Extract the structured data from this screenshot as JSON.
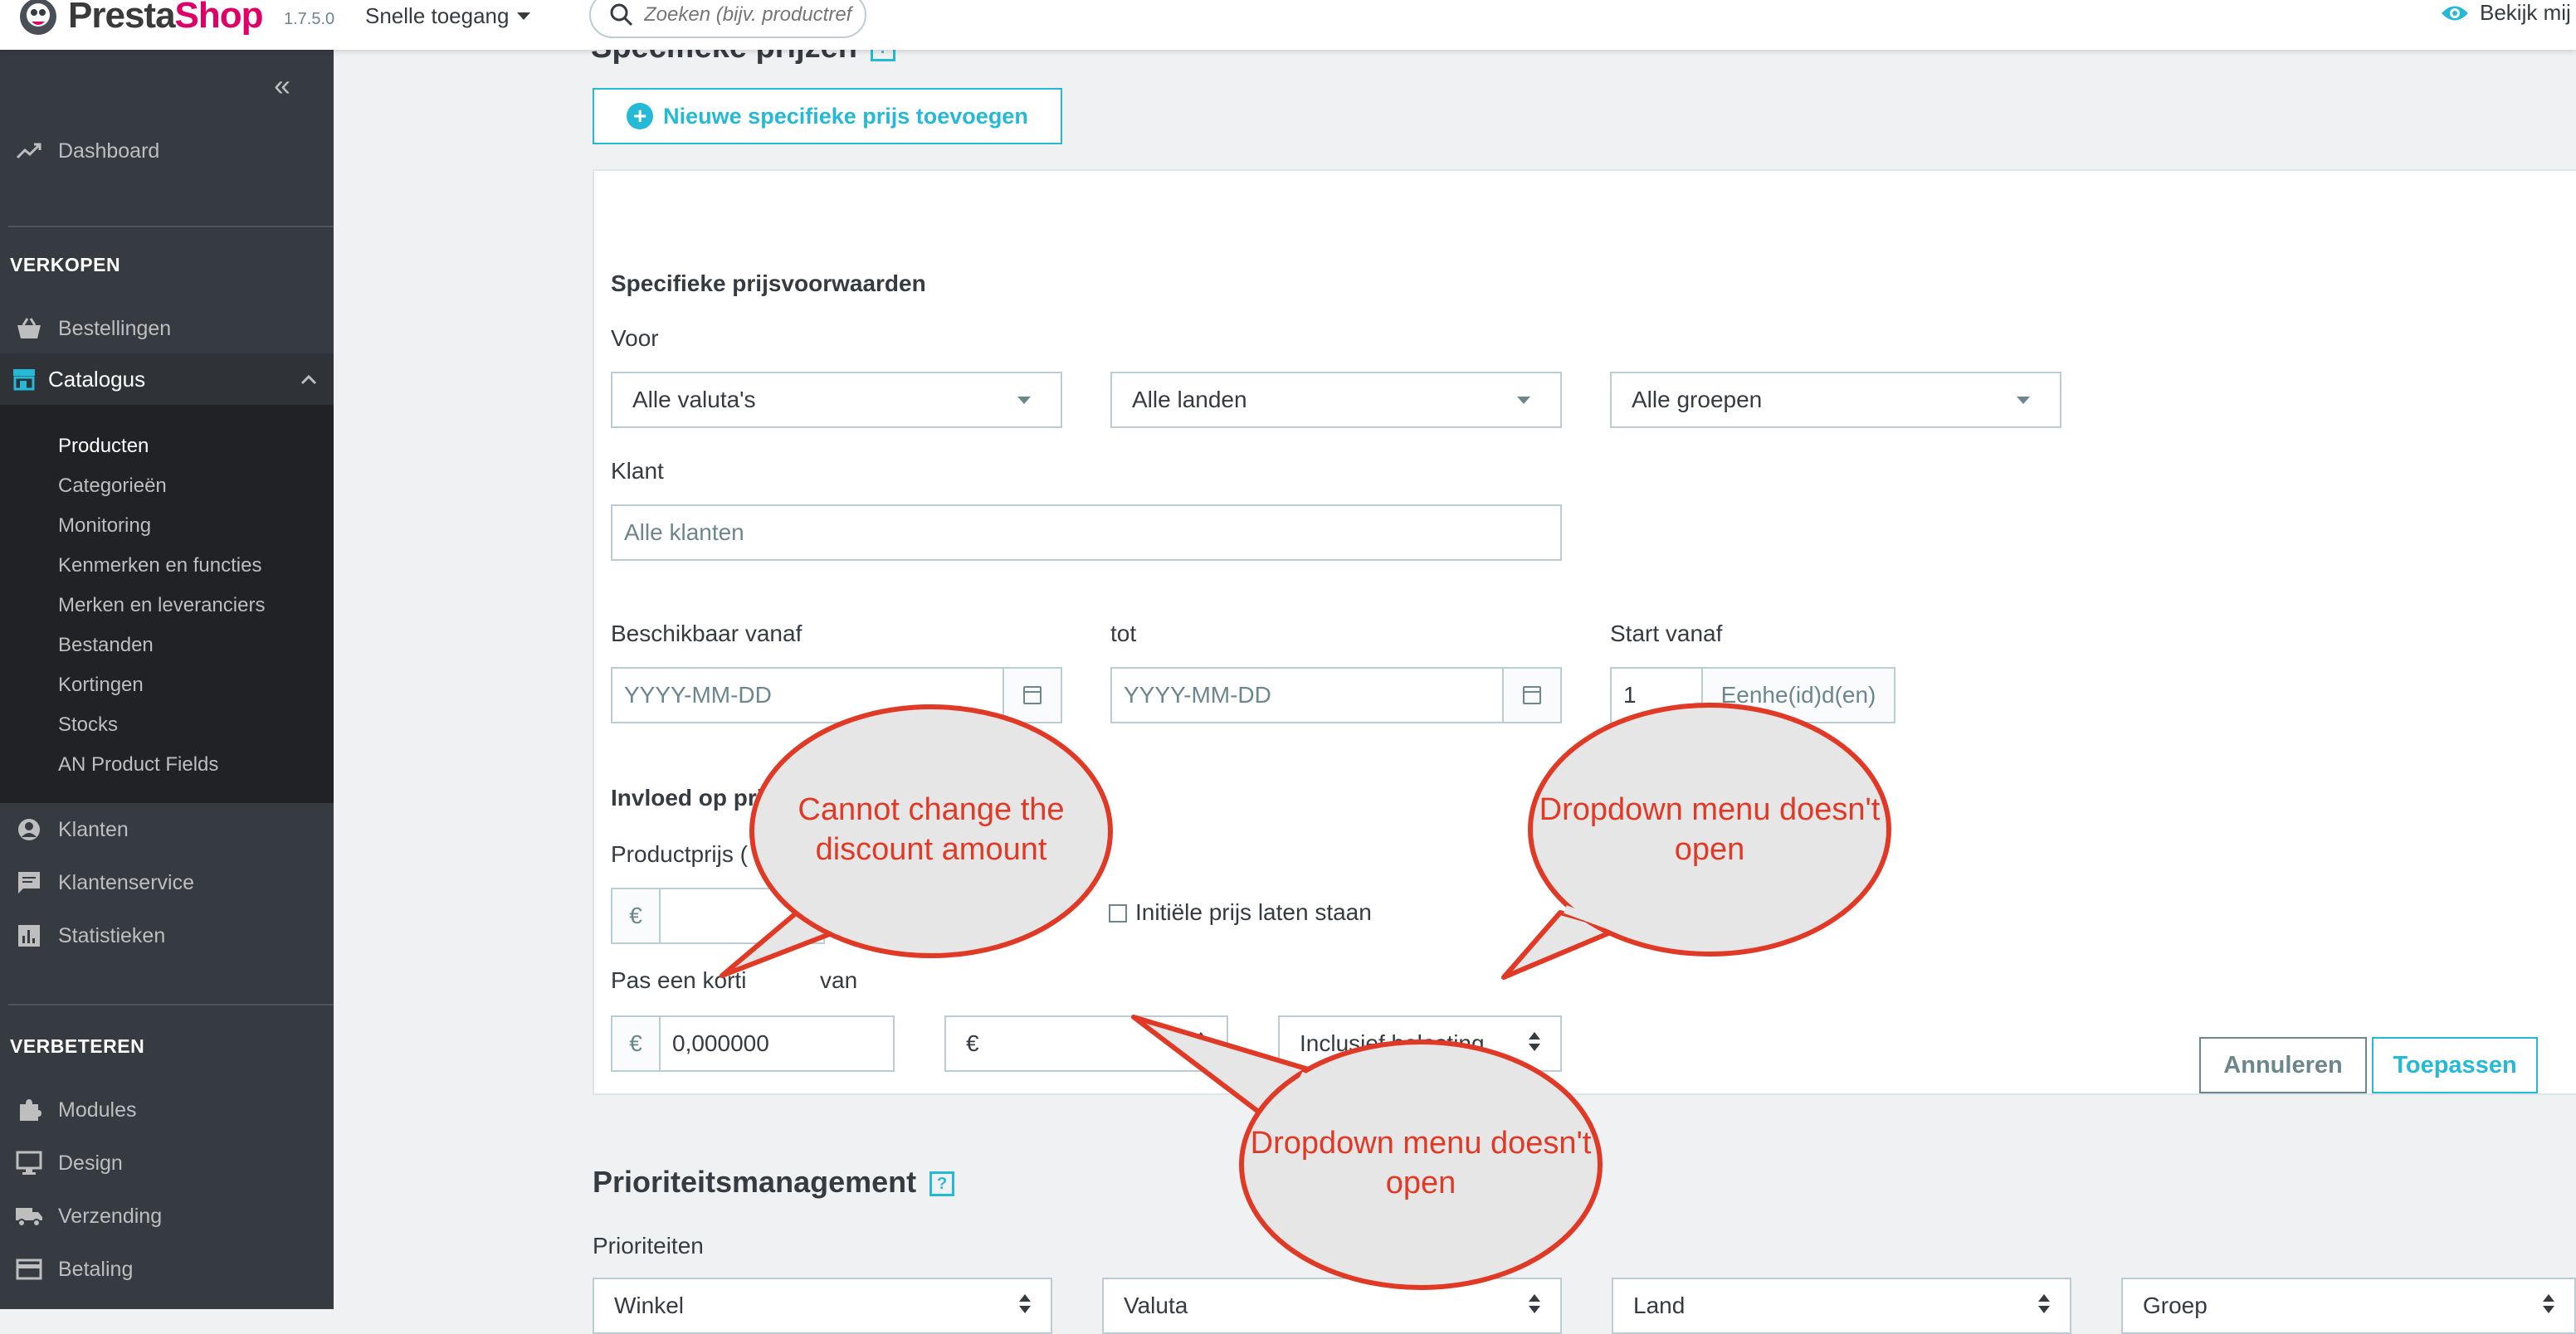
{
  "topbar": {
    "brand_presta": "Presta",
    "brand_shop": "Shop",
    "version": "1.7.5.0",
    "quick_access": "Snelle toegang",
    "search_placeholder": "Zoeken (bijv. productref",
    "view_shop": "Bekijk mij"
  },
  "sidebar": {
    "dashboard": "Dashboard",
    "section_sell": "VERKOPEN",
    "orders": "Bestellingen",
    "catalog": "Catalogus",
    "catalog_items": [
      "Producten",
      "Categorieën",
      "Monitoring",
      "Kenmerken en functies",
      "Merken en leveranciers",
      "Bestanden",
      "Kortingen",
      "Stocks",
      "AN Product Fields"
    ],
    "customers": "Klanten",
    "customer_service": "Klantenservice",
    "stats": "Statistieken",
    "section_improve": "VERBETEREN",
    "modules": "Modules",
    "design": "Design",
    "shipping": "Verzending",
    "payment": "Betaling"
  },
  "main": {
    "top_title": "Specifieke prijzen",
    "add_button": "Nieuwe specifieke prijs toevoegen",
    "conditions_title": "Specifieke prijsvoorwaarden",
    "for_label": "Voor",
    "currency_select": "Alle valuta's",
    "country_select": "Alle landen",
    "group_select": "Alle groepen",
    "customer_label": "Klant",
    "customer_placeholder": "Alle klanten",
    "available_from": "Beschikbaar vanaf",
    "to_label": "tot",
    "start_from": "Start vanaf",
    "date_placeholder": "YYYY-MM-DD",
    "start_qty": "1",
    "units": "Eenhe(id)d(en)",
    "impact_title": "Invloed op prijs",
    "product_price_label": "Productprijs (",
    "currency_symbol": "€",
    "keep_initial": "Initiële prijs laten staan",
    "apply_discount_label": "Pas een korti",
    "apply_discount_label_tail": "van",
    "discount_value": "0,000000",
    "reduction_type": "€",
    "tax_select": "Inclusief belasting",
    "cancel": "Annuleren",
    "apply": "Toepassen",
    "priority_title": "Prioriteitsmanagement",
    "priorities_label": "Prioriteiten",
    "priority_selects": [
      "Winkel",
      "Valuta",
      "Land",
      "Groep"
    ]
  },
  "annotations": {
    "bubble1": "Cannot change the discount amount",
    "bubble2": "Dropdown menu doesn't open",
    "bubble3": "Dropdown menu doesn't open",
    "fill_color": "#e6e6e6",
    "stroke_color": "#e03a27"
  }
}
